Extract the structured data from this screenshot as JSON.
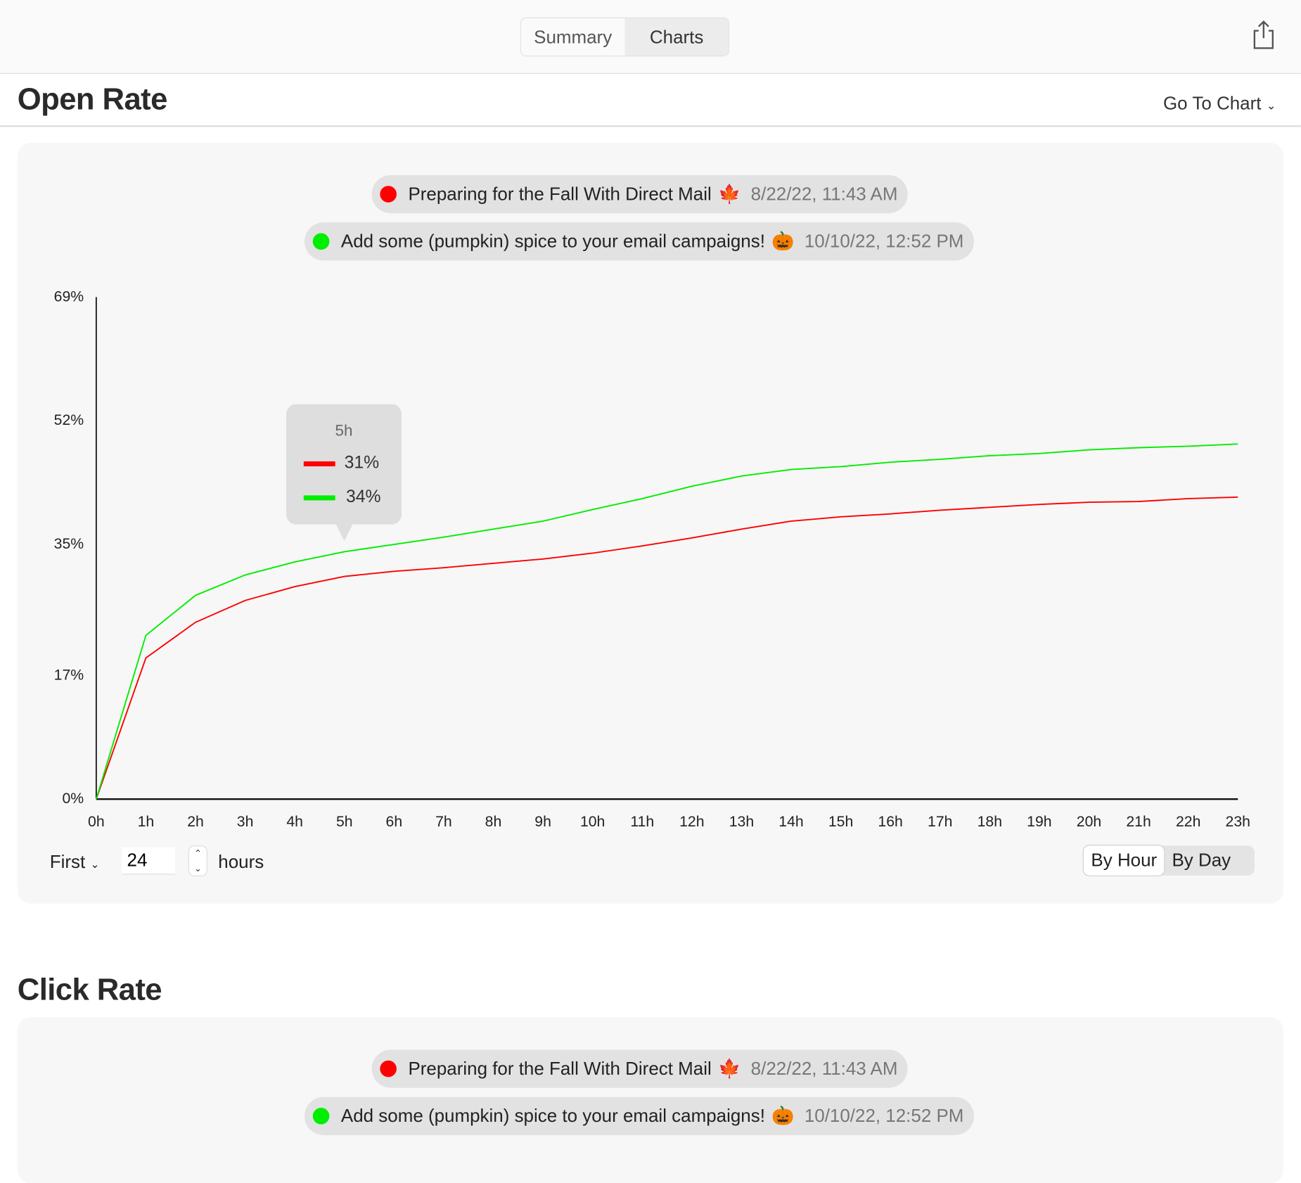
{
  "toolbar": {
    "tabs": [
      {
        "label": "Summary",
        "active": false
      },
      {
        "label": "Charts",
        "active": true
      }
    ],
    "share_icon": "share-icon"
  },
  "sections": [
    {
      "title": "Open Rate",
      "goto_label": "Go To Chart",
      "campaigns": [
        {
          "name": "Preparing for the Fall With Direct Mail",
          "emoji": "🍁",
          "date": "8/22/22, 11:43 AM",
          "color": "#ff0000"
        },
        {
          "name": "Add some (pumpkin) spice to your email campaigns!",
          "emoji": "🎃",
          "date": "10/10/22, 12:52 PM",
          "color": "#00ee00"
        }
      ],
      "tooltip": {
        "label": "5h",
        "values": [
          "31%",
          "34%"
        ]
      },
      "controls": {
        "range_select": "First",
        "hours_value": "24",
        "hours_label": "hours",
        "granularity": [
          {
            "label": "By Hour",
            "active": true
          },
          {
            "label": "By Day",
            "active": false
          }
        ]
      }
    },
    {
      "title": "Click Rate",
      "campaigns": [
        {
          "name": "Preparing for the Fall With Direct Mail",
          "emoji": "🍁",
          "date": "8/22/22, 11:43 AM",
          "color": "#ff0000"
        },
        {
          "name": "Add some (pumpkin) spice to your email campaigns!",
          "emoji": "🎃",
          "date": "10/10/22, 12:52 PM",
          "color": "#00ee00"
        }
      ]
    }
  ],
  "chart_data": {
    "type": "line",
    "x": [
      "0h",
      "1h",
      "2h",
      "3h",
      "4h",
      "5h",
      "6h",
      "7h",
      "8h",
      "9h",
      "10h",
      "11h",
      "12h",
      "13h",
      "14h",
      "15h",
      "16h",
      "17h",
      "18h",
      "19h",
      "20h",
      "21h",
      "22h",
      "23h"
    ],
    "y_ticks": [
      "0%",
      "17%",
      "35%",
      "52%",
      "69%"
    ],
    "ylim": [
      0,
      69
    ],
    "grid": false,
    "series": [
      {
        "color": "#ff0000",
        "values": [
          0,
          19.4,
          24.3,
          27.3,
          29.2,
          30.6,
          31.3,
          31.8,
          32.4,
          33.0,
          33.8,
          34.8,
          35.9,
          37.1,
          38.2,
          38.8,
          39.2,
          39.7,
          40.1,
          40.5,
          40.8,
          40.9,
          41.3,
          41.5
        ]
      },
      {
        "color": "#00ee00",
        "values": [
          0,
          22.5,
          28.0,
          30.8,
          32.6,
          34.0,
          35.0,
          36.0,
          37.1,
          38.2,
          39.8,
          41.3,
          43.0,
          44.4,
          45.3,
          45.7,
          46.3,
          46.7,
          47.2,
          47.5,
          48.0,
          48.3,
          48.5,
          48.8
        ]
      }
    ]
  }
}
